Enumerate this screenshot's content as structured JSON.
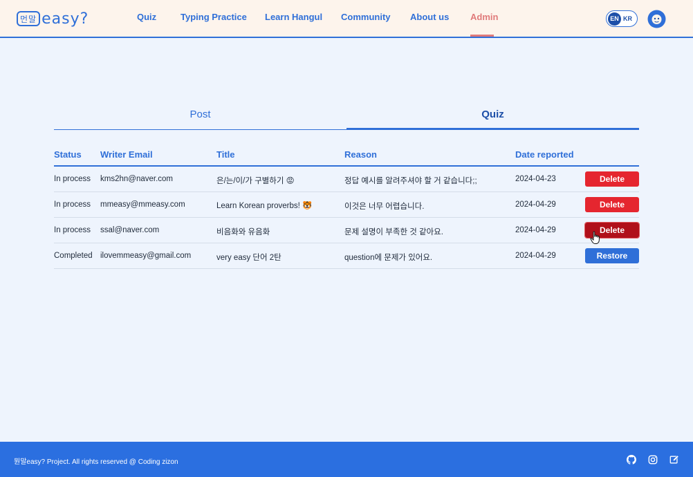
{
  "header": {
    "logo_text": "easy",
    "logo_mark": "먼말",
    "logo_suffix": "?",
    "nav": [
      "Quiz",
      "Typing Practice",
      "Learn Hangul",
      "Community",
      "About us",
      "Admin"
    ],
    "active_nav": "Admin",
    "lang": {
      "en": "EN",
      "kr": "KR"
    }
  },
  "tabs": {
    "post": "Post",
    "quiz": "Quiz",
    "active": "Quiz"
  },
  "table": {
    "headers": [
      "Status",
      "Writer Email",
      "Title",
      "Reason",
      "Date reported"
    ],
    "rows": [
      {
        "status": "In process",
        "email": "kms2hn@naver.com",
        "title": "은/는/이/가 구별하기 😡",
        "reason": "정답 예시를 알려주셔야 할 거 같습니다;;",
        "date": "2024-04-23",
        "action": "Delete"
      },
      {
        "status": "In process",
        "email": "mmeasy@mmeasy.com",
        "title": "Learn Korean proverbs! 🐯",
        "reason": "이것은 너무 어렵습니다.",
        "date": "2024-04-29",
        "action": "Delete"
      },
      {
        "status": "In process",
        "email": "ssal@naver.com",
        "title": "비음화와 유음화",
        "reason": "문제 설명이 부족한 것 같아요.",
        "date": "2024-04-29",
        "action": "Delete"
      },
      {
        "status": "Completed",
        "email": "ilovemmeasy@gmail.com",
        "title": "very easy 단어 2탄",
        "reason": "question에 문제가 있어요.",
        "date": "2024-04-29",
        "action": "Restore"
      }
    ]
  },
  "footer": {
    "text": "뭔말easy? Project. All rights reserved @ Coding zizon"
  },
  "colors": {
    "primary": "#2f6fd8",
    "delete": "#e5262f",
    "delete_hover": "#b0101a",
    "active_nav": "#e07a7a",
    "footer_bg": "#2b6fe0"
  },
  "icons": [
    "avatar-icon",
    "github-icon",
    "instagram-icon",
    "edit-icon",
    "cursor-icon"
  ]
}
